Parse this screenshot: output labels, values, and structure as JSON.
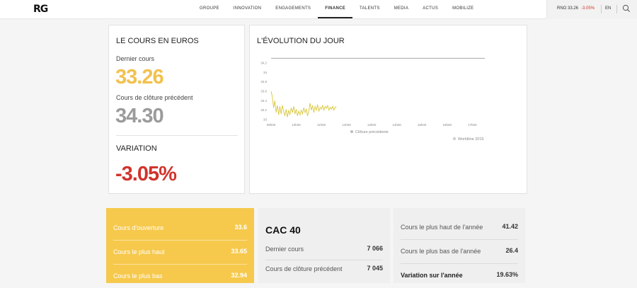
{
  "header": {
    "logo": "RG",
    "nav": [
      "GROUPE",
      "INNOVATION",
      "ENGAGEMENTS",
      "FINANCE",
      "TALENTS",
      "MEDIA",
      "ACTUS",
      "MOBILIZE"
    ],
    "active_nav": "FINANCE",
    "ticker_text": "RNO 33.26",
    "ticker_change": "-3.05%",
    "lang": "EN"
  },
  "cours": {
    "title": "LE COURS EN EUROS",
    "last_label": "Dernier cours",
    "last_value": "33.26",
    "close_label": "Cours de clôture précédent",
    "close_value": "34.30",
    "variation_title": "VARIATION",
    "variation_value": "-3.05%"
  },
  "evolution": {
    "title": "L'ÉVOLUTION DU JOUR",
    "legend_1": "Clôture précédente",
    "legend_2": "Worldline 2015"
  },
  "chart_data": {
    "type": "line",
    "y_ticks": [
      "34.2",
      "34",
      "33.8",
      "33.6",
      "33.4",
      "33.2",
      "33"
    ],
    "x_ticks": [
      "09h00",
      "10h00",
      "11h00",
      "12h00",
      "13h00",
      "14h00",
      "15h00",
      "16h00",
      "17h00"
    ],
    "ylim": [
      33,
      34.2
    ],
    "xlim": [
      9,
      17.5
    ],
    "reference_line": 34.3,
    "series": [
      {
        "name": "",
        "x": [
          9.0,
          9.05,
          9.1,
          9.15,
          9.2,
          9.25,
          9.3,
          9.35,
          9.4,
          9.45,
          9.5,
          9.55,
          9.6,
          9.65,
          9.7,
          9.75,
          9.8,
          9.85,
          9.9,
          9.95,
          10.0,
          10.05,
          10.1,
          10.15,
          10.2,
          10.25,
          10.3,
          10.35,
          10.4,
          10.45,
          10.5,
          10.55,
          10.6,
          10.65,
          10.7,
          10.75,
          10.8,
          10.85,
          10.9,
          10.95,
          11.0,
          11.05,
          11.1,
          11.15,
          11.2,
          11.25,
          11.3,
          11.35,
          11.4,
          11.45,
          11.5,
          11.55,
          11.6
        ],
        "y": [
          33.6,
          33.48,
          33.25,
          33.4,
          33.15,
          33.3,
          33.1,
          33.28,
          33.12,
          33.3,
          33.18,
          33.08,
          33.22,
          33.05,
          33.2,
          33.1,
          33.25,
          33.15,
          33.28,
          33.12,
          33.22,
          33.08,
          33.18,
          33.1,
          33.2,
          33.12,
          33.25,
          33.15,
          33.22,
          33.08,
          33.18,
          33.35,
          33.2,
          33.3,
          33.15,
          33.28,
          33.2,
          33.32,
          33.18,
          33.26,
          33.22,
          33.3,
          33.2,
          33.28,
          33.24,
          33.3,
          33.2,
          33.26,
          33.22,
          33.28,
          33.2,
          33.27,
          33.26
        ]
      }
    ]
  },
  "ouverture": {
    "rows": [
      {
        "label": "Cours d'ouverture",
        "value": "33.6"
      },
      {
        "label": "Cours le plus haut",
        "value": "33.65"
      },
      {
        "label": "Cours le plus bas",
        "value": "32.94"
      }
    ]
  },
  "cac40": {
    "title": "CAC 40",
    "rows": [
      {
        "label": "Dernier cours",
        "value": "7 066"
      },
      {
        "label": "Cours de clôture précédent",
        "value": "7 045"
      }
    ]
  },
  "annee": {
    "rows": [
      {
        "label": "Cours le plus haut de l'année",
        "value": "41.42"
      },
      {
        "label": "Cours le plus bas de l'année",
        "value": "26.4"
      },
      {
        "label": "Variation sur l'année",
        "value": "19.63%"
      }
    ]
  },
  "colors": {
    "accent_yellow": "#f6c94d",
    "negative_red": "#d0342c",
    "line_yellow": "#d9c63a"
  }
}
